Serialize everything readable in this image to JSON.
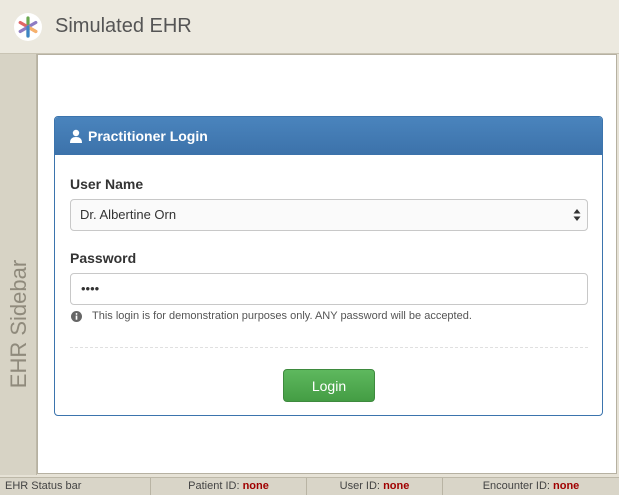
{
  "header": {
    "title": "Simulated EHR",
    "logo_icon": "asterisk-multicolor-icon"
  },
  "sidebar": {
    "label": "EHR Sidebar"
  },
  "login_panel": {
    "heading": "Practitioner Login",
    "heading_icon": "user-icon",
    "username_label": "User Name",
    "username_selected": "Dr. Albertine Orn",
    "password_label": "Password",
    "password_value": "••••",
    "help_text": "This login is for demonstration purposes only. ANY password will be accepted.",
    "help_icon": "info-circle-icon",
    "login_button": "Login"
  },
  "statusbar": {
    "title": "EHR Status bar",
    "patient_label": "Patient ID:",
    "patient_value": "none",
    "user_label": "User ID:",
    "user_value": "none",
    "encounter_label": "Encounter ID:",
    "encounter_value": "none"
  },
  "colors": {
    "panel_header": "#3c72aa",
    "login_button": "#449d44",
    "status_value": "#a00000"
  }
}
